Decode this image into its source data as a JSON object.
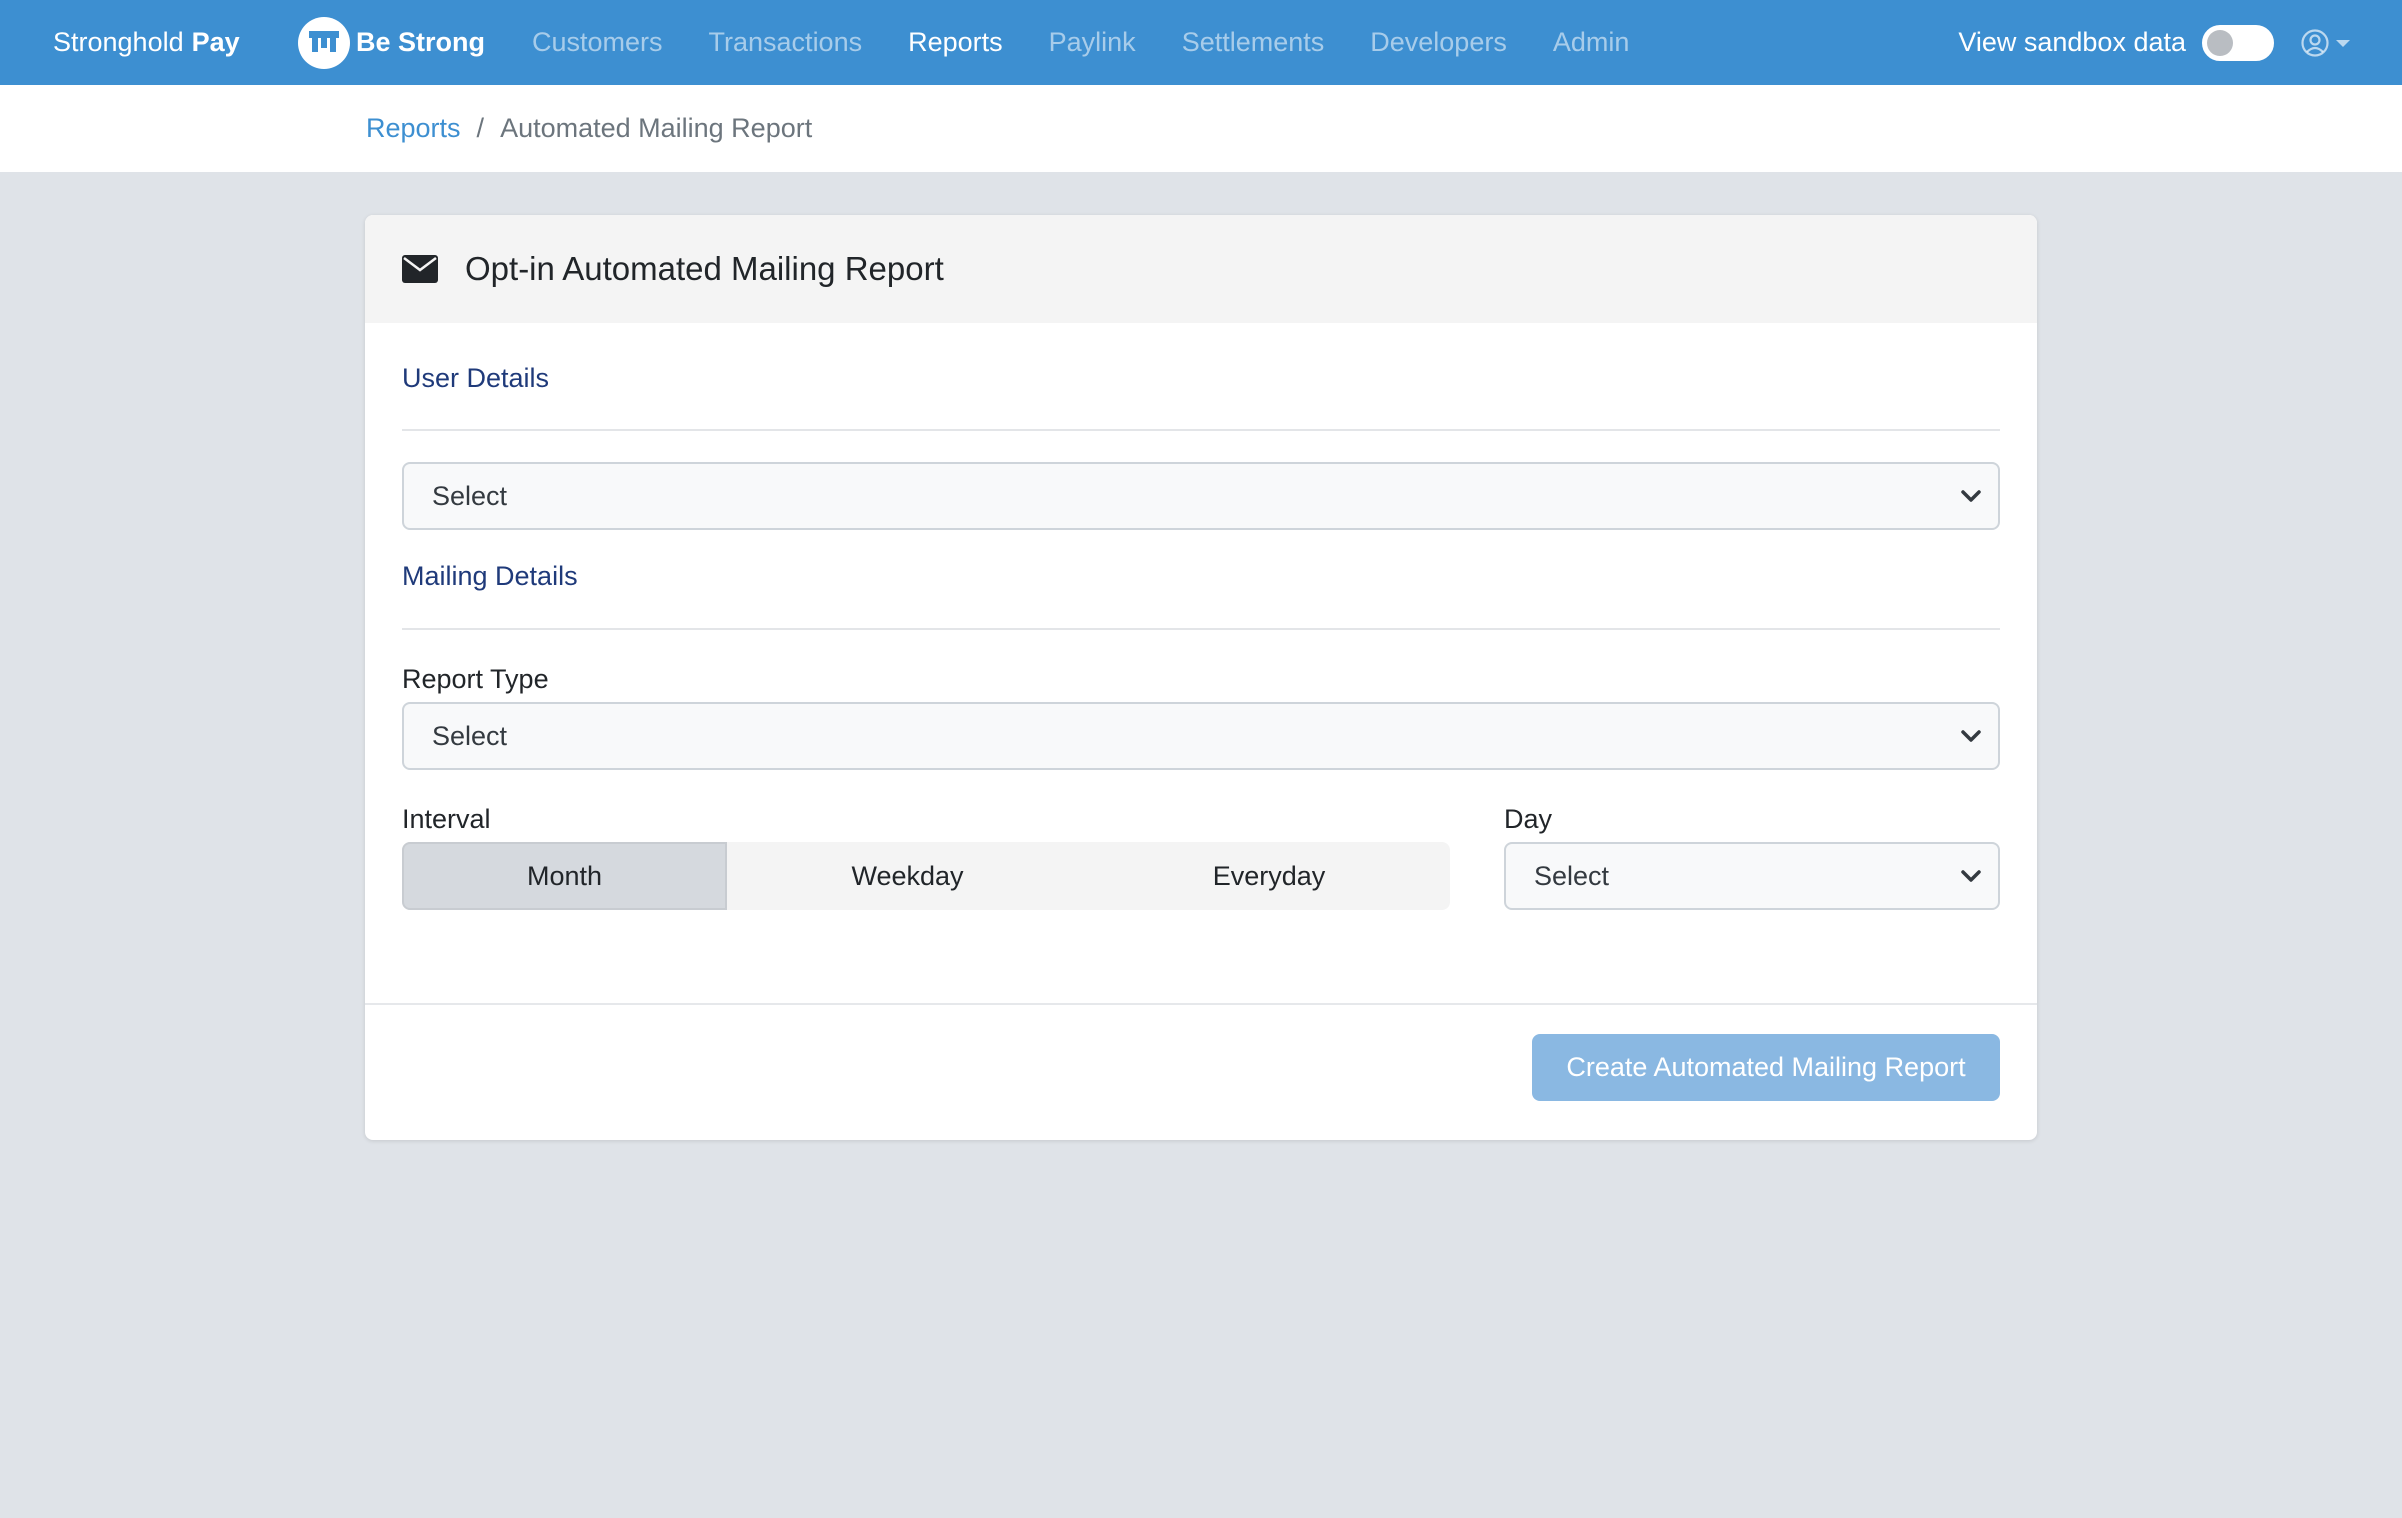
{
  "navbar": {
    "brand_light": "Stronghold",
    "brand_bold": "Pay",
    "company_name": "Be Strong",
    "links": [
      {
        "label": "Customers",
        "active": false
      },
      {
        "label": "Transactions",
        "active": false
      },
      {
        "label": "Reports",
        "active": true
      },
      {
        "label": "Paylink",
        "active": false
      },
      {
        "label": "Settlements",
        "active": false
      },
      {
        "label": "Developers",
        "active": false
      },
      {
        "label": "Admin",
        "active": false
      }
    ],
    "sandbox_label": "View sandbox data",
    "sandbox_enabled": false,
    "user_icon": "user-circle-icon",
    "accent_color": "#3d8fd1"
  },
  "breadcrumb": {
    "parent": "Reports",
    "separator": "/",
    "current": "Automated Mailing Report"
  },
  "card": {
    "header_icon": "envelope-icon",
    "title": "Opt-in Automated Mailing Report",
    "user_details": {
      "section_title": "User Details",
      "user_select_value": "Select"
    },
    "mailing_details": {
      "section_title": "Mailing Details",
      "report_type_label": "Report Type",
      "report_type_value": "Select",
      "interval_label": "Interval",
      "interval_options": [
        {
          "label": "Month",
          "selected": true
        },
        {
          "label": "Weekday",
          "selected": false
        },
        {
          "label": "Everyday",
          "selected": false
        }
      ],
      "day_label": "Day",
      "day_value": "Select"
    },
    "submit_label": "Create Automated Mailing Report"
  }
}
